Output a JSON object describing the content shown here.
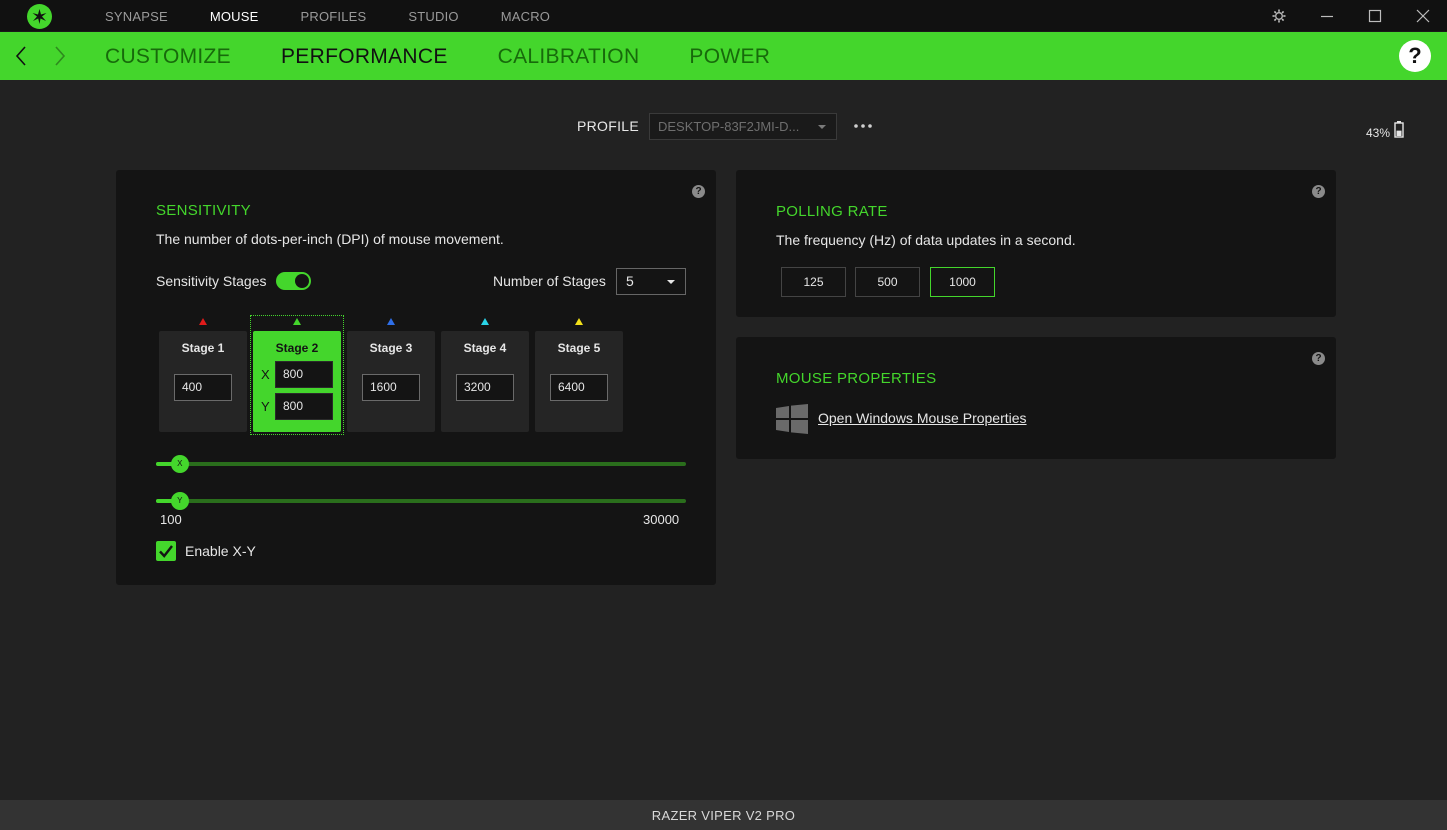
{
  "topnav": [
    "SYNAPSE",
    "MOUSE",
    "PROFILES",
    "STUDIO",
    "MACRO"
  ],
  "topnav_active": "MOUSE",
  "subnav": [
    "CUSTOMIZE",
    "PERFORMANCE",
    "CALIBRATION",
    "POWER"
  ],
  "subnav_active": "PERFORMANCE",
  "help_label": "?",
  "profile": {
    "label": "PROFILE",
    "value": "DESKTOP-83F2JMI-D..."
  },
  "battery": {
    "percent": "43%",
    "level": 0.43
  },
  "sensitivity": {
    "title": "SENSITIVITY",
    "description": "The number of dots-per-inch (DPI) of mouse movement.",
    "stages_toggle_label": "Sensitivity Stages",
    "stages_enabled": true,
    "number_of_stages_label": "Number of Stages",
    "number_of_stages": "5",
    "stages": [
      {
        "name": "Stage 1",
        "value": "400",
        "color": "#e01b1b"
      },
      {
        "name": "Stage 2",
        "x": "800",
        "y": "800",
        "color": "#44d62c"
      },
      {
        "name": "Stage 3",
        "value": "1600",
        "color": "#2f6fe8"
      },
      {
        "name": "Stage 4",
        "value": "3200",
        "color": "#2ad4e8"
      },
      {
        "name": "Stage 5",
        "value": "6400",
        "color": "#f2e01a"
      }
    ],
    "axis_x": "X",
    "axis_y": "Y",
    "slider_min": "100",
    "slider_max": "30000",
    "slider_x_value": 800,
    "slider_y_value": 800,
    "enable_xy_label": "Enable X-Y",
    "enable_xy": true
  },
  "polling": {
    "title": "POLLING RATE",
    "description": "The frequency (Hz) of data updates in a second.",
    "options": [
      "125",
      "500",
      "1000"
    ],
    "selected": "1000"
  },
  "mouse_properties": {
    "title": "MOUSE PROPERTIES",
    "link": "Open Windows Mouse Properties"
  },
  "device_name": "RAZER VIPER V2 PRO",
  "colors": {
    "accent": "#44d62c",
    "background": "#222222",
    "panel": "#141414"
  },
  "icons": [
    "razer-logo-icon",
    "settings-icon",
    "minimize-icon",
    "maximize-icon",
    "close-icon",
    "back-arrow-icon",
    "forward-arrow-icon",
    "help-icon",
    "more-icon",
    "battery-icon",
    "windows-icon",
    "check-icon"
  ]
}
